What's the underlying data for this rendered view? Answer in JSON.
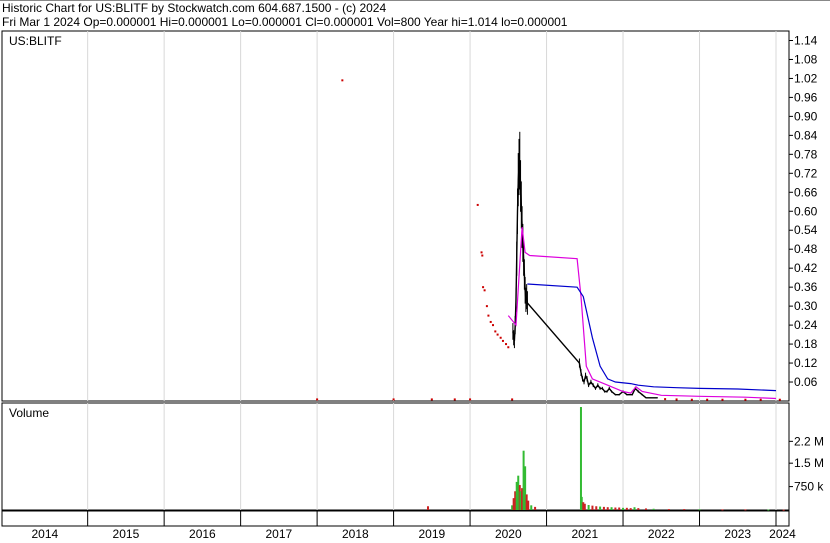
{
  "header": {
    "line1": "Historic Chart for US:BLITF by Stockwatch.com 604.687.1500 - (c) 2024",
    "line2": "Fri Mar  1 2024   Op=0.000001   Hi=0.000001   Lo=0.000001   Cl=0.000001   Vol=800   Year hi=1.014   lo=0.000001"
  },
  "chart_data": {
    "type": "line",
    "title": "US:BLITF",
    "price_axis": {
      "ticks": [
        "1.14",
        "1.08",
        "1.02",
        "0.96",
        "0.90",
        "0.84",
        "0.78",
        "0.72",
        "0.66",
        "0.60",
        "0.54",
        "0.48",
        "0.42",
        "0.36",
        "0.30",
        "0.24",
        "0.18",
        "0.12",
        "0.06"
      ],
      "range": [
        0,
        1.17
      ]
    },
    "volume_panel": {
      "label": "Volume",
      "ticks": [
        "2.2 M",
        "1.5 M",
        "750 k"
      ],
      "range": [
        0,
        3300000
      ]
    },
    "x_axis": {
      "years": [
        "2014",
        "2015",
        "2016",
        "2017",
        "2018",
        "2019",
        "2020",
        "2021",
        "2022",
        "2023",
        "2024"
      ],
      "range": [
        2013.88,
        2024.17
      ]
    },
    "colors": {
      "price": "#000000",
      "red_ticks": "#cc0000",
      "ma_short": "#dd00dd",
      "ma_long": "#0000cc",
      "vol_up": "#33bb33",
      "vol_down": "#cc2222"
    },
    "series": [
      {
        "kind": "price_hl",
        "points": [
          [
            2020.56,
            0.22
          ],
          [
            2020.57,
            0.2
          ],
          [
            2020.58,
            0.19
          ],
          [
            2020.59,
            0.24
          ],
          [
            2020.6,
            0.32
          ],
          [
            2020.61,
            0.45
          ],
          [
            2020.62,
            0.6
          ],
          [
            2020.63,
            0.7
          ],
          [
            2020.64,
            0.74
          ],
          [
            2020.65,
            0.76
          ],
          [
            2020.66,
            0.68
          ],
          [
            2020.67,
            0.62
          ],
          [
            2020.68,
            0.55
          ],
          [
            2020.69,
            0.5
          ],
          [
            2020.7,
            0.45
          ],
          [
            2020.71,
            0.4
          ],
          [
            2020.72,
            0.35
          ],
          [
            2020.73,
            0.32
          ],
          [
            2020.74,
            0.33
          ],
          [
            2020.75,
            0.31
          ],
          [
            2021.43,
            0.12
          ],
          [
            2021.45,
            0.09
          ],
          [
            2021.47,
            0.07
          ],
          [
            2021.49,
            0.06
          ],
          [
            2021.51,
            0.08
          ],
          [
            2021.53,
            0.07
          ],
          [
            2021.55,
            0.05
          ],
          [
            2021.58,
            0.06
          ],
          [
            2021.61,
            0.05
          ],
          [
            2021.64,
            0.04
          ],
          [
            2021.67,
            0.05
          ],
          [
            2021.7,
            0.04
          ],
          [
            2021.73,
            0.04
          ],
          [
            2021.76,
            0.03
          ],
          [
            2021.79,
            0.03
          ],
          [
            2021.82,
            0.04
          ],
          [
            2021.85,
            0.03
          ],
          [
            2021.9,
            0.02
          ],
          [
            2021.95,
            0.02
          ],
          [
            2022.0,
            0.03
          ],
          [
            2022.05,
            0.02
          ],
          [
            2022.12,
            0.02
          ],
          [
            2022.16,
            0.04
          ],
          [
            2022.2,
            0.03
          ],
          [
            2022.25,
            0.02
          ],
          [
            2022.3,
            0.01
          ],
          [
            2022.36,
            0.01
          ],
          [
            2022.45,
            0.01
          ]
        ]
      },
      {
        "kind": "ma_short",
        "points": [
          [
            2020.5,
            0.27
          ],
          [
            2020.6,
            0.24
          ],
          [
            2020.68,
            0.55
          ],
          [
            2020.72,
            0.47
          ],
          [
            2020.78,
            0.46
          ],
          [
            2021.4,
            0.45
          ],
          [
            2021.45,
            0.33
          ],
          [
            2021.52,
            0.11
          ],
          [
            2021.6,
            0.07
          ],
          [
            2021.8,
            0.05
          ],
          [
            2022.0,
            0.03
          ],
          [
            2022.1,
            0.025
          ],
          [
            2022.17,
            0.045
          ],
          [
            2022.25,
            0.03
          ],
          [
            2022.5,
            0.018
          ],
          [
            2023.0,
            0.015
          ],
          [
            2023.6,
            0.012
          ],
          [
            2024.0,
            0.008
          ]
        ]
      },
      {
        "kind": "ma_long",
        "points": [
          [
            2020.75,
            0.37
          ],
          [
            2021.4,
            0.36
          ],
          [
            2021.48,
            0.33
          ],
          [
            2021.6,
            0.2
          ],
          [
            2021.7,
            0.11
          ],
          [
            2021.8,
            0.07
          ],
          [
            2021.9,
            0.06
          ],
          [
            2022.1,
            0.055
          ],
          [
            2022.2,
            0.05
          ],
          [
            2022.4,
            0.045
          ],
          [
            2022.7,
            0.042
          ],
          [
            2023.0,
            0.04
          ],
          [
            2023.5,
            0.038
          ],
          [
            2024.0,
            0.033
          ]
        ]
      }
    ],
    "scatter": [
      [
        2018.33,
        1.014
      ],
      [
        2020.1,
        0.62
      ],
      [
        2020.15,
        0.47
      ],
      [
        2020.16,
        0.46
      ],
      [
        2020.17,
        0.36
      ],
      [
        2020.19,
        0.35
      ],
      [
        2020.22,
        0.3
      ],
      [
        2020.24,
        0.27
      ],
      [
        2020.27,
        0.25
      ],
      [
        2020.3,
        0.24
      ],
      [
        2020.33,
        0.22
      ],
      [
        2020.36,
        0.21
      ],
      [
        2020.4,
        0.2
      ],
      [
        2020.43,
        0.19
      ],
      [
        2020.47,
        0.18
      ],
      [
        2020.5,
        0.17
      ],
      [
        2018.0,
        0.005
      ],
      [
        2019.0,
        0.005
      ],
      [
        2019.5,
        0.005
      ],
      [
        2019.8,
        0.005
      ],
      [
        2020.0,
        0.005
      ],
      [
        2020.55,
        0.005
      ],
      [
        2022.55,
        0.006
      ],
      [
        2022.7,
        0.005
      ],
      [
        2022.9,
        0.004
      ],
      [
        2023.1,
        0.004
      ],
      [
        2023.3,
        0.004
      ],
      [
        2023.6,
        0.004
      ],
      [
        2023.8,
        0.004
      ],
      [
        2024.05,
        0.004
      ]
    ],
    "volume": [
      [
        2019.45,
        120000
      ],
      [
        2020.55,
        150000
      ],
      [
        2020.57,
        380000
      ],
      [
        2020.59,
        600000
      ],
      [
        2020.61,
        900000
      ],
      [
        2020.63,
        1100000
      ],
      [
        2020.65,
        800000
      ],
      [
        2020.66,
        600000
      ],
      [
        2020.68,
        700000
      ],
      [
        2020.7,
        1900000
      ],
      [
        2020.72,
        1400000
      ],
      [
        2020.74,
        500000
      ],
      [
        2020.76,
        300000
      ],
      [
        2020.8,
        150000
      ],
      [
        2020.85,
        100000
      ],
      [
        2021.45,
        3300000
      ],
      [
        2021.46,
        420000
      ],
      [
        2021.48,
        250000
      ],
      [
        2021.5,
        200000
      ],
      [
        2021.55,
        160000
      ],
      [
        2021.6,
        140000
      ],
      [
        2021.65,
        120000
      ],
      [
        2021.7,
        110000
      ],
      [
        2021.75,
        100000
      ],
      [
        2021.8,
        90000
      ],
      [
        2021.85,
        90000
      ],
      [
        2021.9,
        80000
      ],
      [
        2021.95,
        80000
      ],
      [
        2022.0,
        70000
      ],
      [
        2022.05,
        70000
      ],
      [
        2022.1,
        60000
      ],
      [
        2022.15,
        90000
      ],
      [
        2022.2,
        60000
      ],
      [
        2022.3,
        50000
      ],
      [
        2022.4,
        40000
      ],
      [
        2022.6,
        30000
      ],
      [
        2022.8,
        30000
      ],
      [
        2023.0,
        25000
      ],
      [
        2023.3,
        20000
      ],
      [
        2023.6,
        20000
      ],
      [
        2023.9,
        15000
      ],
      [
        2024.1,
        10000
      ]
    ]
  }
}
